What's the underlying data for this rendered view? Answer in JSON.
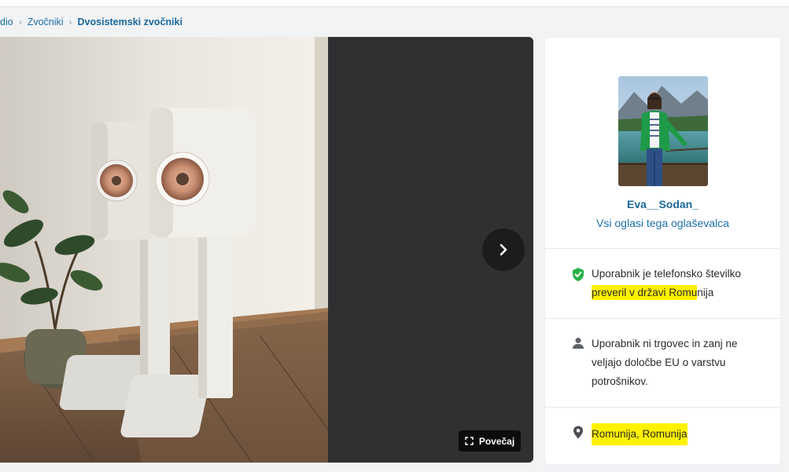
{
  "breadcrumb": {
    "items": [
      "dio",
      "Zvočniki",
      "Dvosistemski zvočniki"
    ]
  },
  "gallery": {
    "next_label": "›",
    "zoom_label": "Povečaj"
  },
  "seller": {
    "name": "Eva__Sodan_",
    "all_ads_link": "Vsi oglasi tega oglaševalca",
    "verified": {
      "icon": "shield-check-icon",
      "line1": "Uporabnik je telefonsko številko",
      "line2_pre": "preveril v državi Romu",
      "line2_post": "nija",
      "highlight_color": "#fff200"
    },
    "consumer_notice": {
      "icon": "person-icon",
      "lines": [
        "Uporabnik ni trgovec in zanj ne",
        "veljajo določbe EU o varstvu",
        "potrošnikov."
      ]
    },
    "location": {
      "icon": "location-pin-icon",
      "text": "Romunija, Romunija"
    }
  },
  "colors": {
    "link": "#1d6fa5",
    "verified_green": "#2ab24a",
    "highlight": "#fff200"
  }
}
